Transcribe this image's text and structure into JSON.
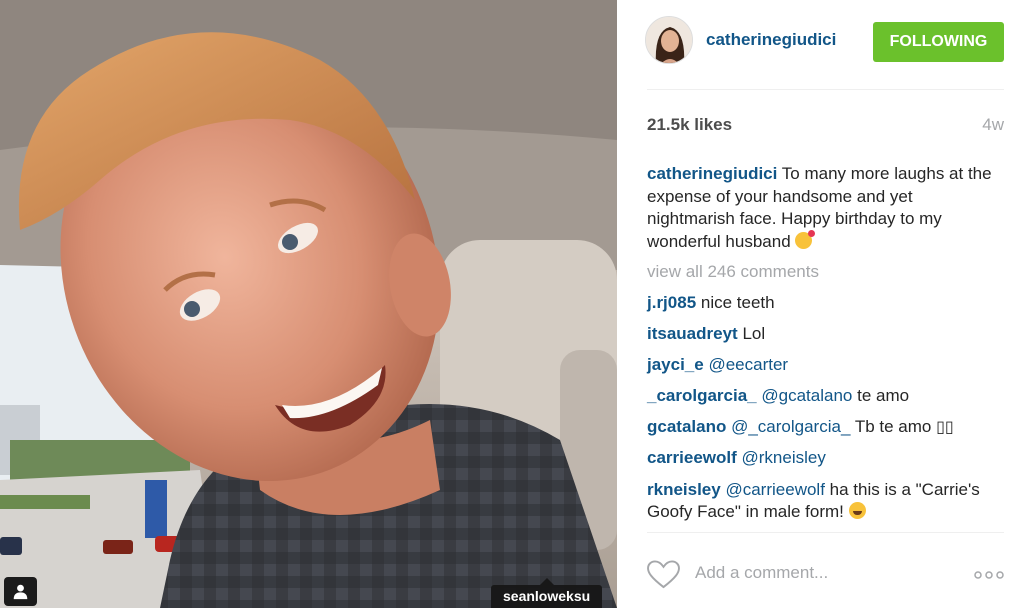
{
  "photo": {
    "tag_label": "seanloweksu",
    "user_tag_icon": "person-icon"
  },
  "header": {
    "username": "catherinegiudici",
    "follow_button": "FOLLOWING",
    "accent_color": "#6bc12c",
    "link_color": "#125688"
  },
  "stats": {
    "likes": "21.5k likes",
    "age": "4w"
  },
  "caption": {
    "username": "catherinegiudici",
    "text": "To many more laughs at the expense of your handsome and yet nightmarish face. Happy birthday to my wonderful husband",
    "emoji": "kiss-emoji"
  },
  "view_all": "view all 246 comments",
  "comments": [
    {
      "username": "j.rj085",
      "text": "nice teeth"
    },
    {
      "username": "itsauadreyt",
      "text": "Lol"
    },
    {
      "username": "jayci_e",
      "mention": "@eecarter",
      "text": ""
    },
    {
      "username": "_carolgarcia_",
      "mention": "@gcatalano",
      "text": "te amo"
    },
    {
      "username": "gcatalano",
      "mention": "@_carolgarcia_",
      "text": "Tb te amo",
      "glyphs": "▯▯"
    },
    {
      "username": "carrieewolf",
      "mention": "@rkneisley",
      "text": ""
    },
    {
      "username": "rkneisley",
      "mention": "@carrieewolf",
      "text": "ha this is a \"Carrie's Goofy Face\" in male form!",
      "emoji": "laughing-emoji"
    }
  ],
  "footer": {
    "add_comment_placeholder": "Add a comment...",
    "like_icon": "heart-icon",
    "more_icon": "more-options-icon"
  }
}
